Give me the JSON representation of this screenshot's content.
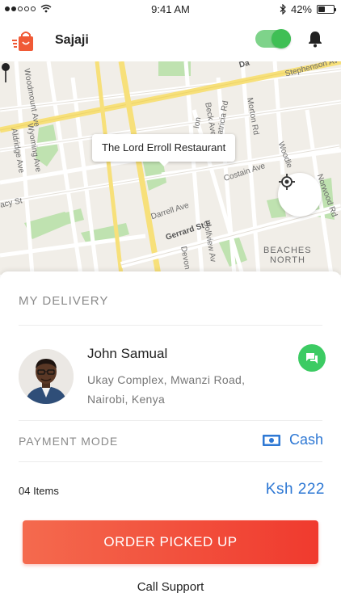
{
  "status_bar": {
    "time": "9:41 AM",
    "battery": "42%",
    "battery_level": 0.42,
    "signal_bars": 2,
    "icons": [
      "signal-dots-icon",
      "wifi-icon",
      "bluetooth-icon",
      "battery-icon"
    ]
  },
  "header": {
    "app_name": "Sajaji",
    "online_toggle": true,
    "icons": [
      "shopping-bag-logo-icon",
      "bell-icon"
    ]
  },
  "map": {
    "callout": "The Lord Erroll Restaurant",
    "street_labels": [
      "Stephenson Av",
      "Beck Ave",
      "Morton Rd",
      "Patricia Rd",
      "Ion",
      "Woodmount Ave",
      "Wyoming Ave",
      "Aldridge Ave",
      "acy St",
      "Costain Ave",
      "Darrell Ave",
      "Gerrard St E",
      "Golfview Av",
      "Devon",
      "Woodle",
      "Norwood Rd",
      "Da"
    ],
    "area_labels": [
      "BEACHES",
      "NORTH"
    ],
    "icons": [
      "map-pin-icon",
      "locate-crosshair-icon"
    ]
  },
  "delivery": {
    "section_title": "MY DELIVERY",
    "customer_name": "John Samual",
    "address_line1": "Ukay Complex, Mwanzi Road,",
    "address_line2": "Nairobi, Kenya",
    "icons": [
      "avatar",
      "chat-icon"
    ]
  },
  "payment": {
    "label": "PAYMENT MODE",
    "method": "Cash",
    "icon": "cash-icon"
  },
  "summary": {
    "items": "04 Items",
    "total": "Ksh 222"
  },
  "actions": {
    "primary": "ORDER PICKED UP",
    "secondary": "Call Support"
  },
  "colors": {
    "accent_blue": "#2e78d4",
    "cta_start": "#f46a4e",
    "cta_end": "#f03a2e",
    "chat_green": "#3ccb63",
    "toggle_green": "#3fbf55"
  }
}
